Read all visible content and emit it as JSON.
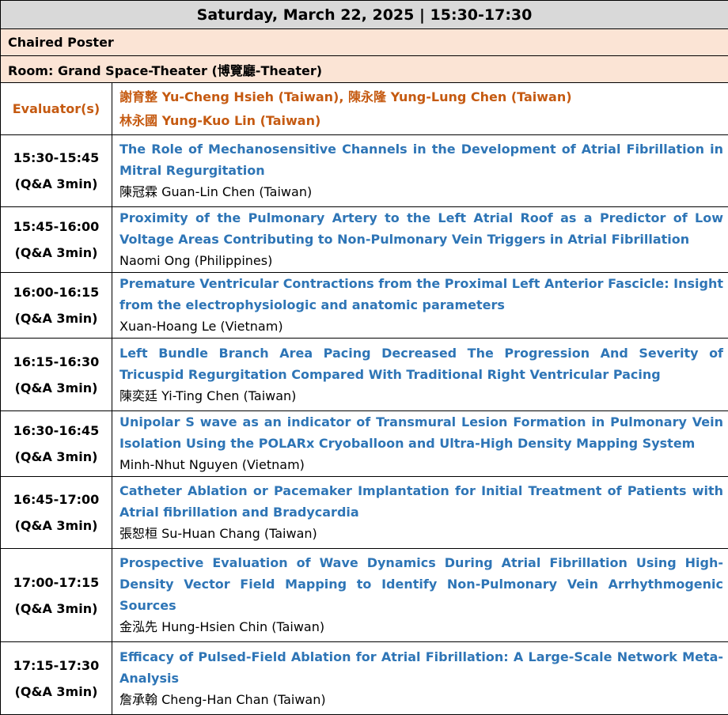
{
  "header": {
    "date_time": "Saturday, March 22, 2025 | 15:30-17:30",
    "session_type": "Chaired Poster",
    "room": "Room: Grand Space-Theater (博覽廳-Theater)"
  },
  "evaluators": {
    "label": "Evaluator(s)",
    "line1": "謝育整 Yu-Cheng Hsieh (Taiwan), 陳永隆 Yung-Lung Chen (Taiwan)",
    "line2": "林永國 Yung-Kuo Lin (Taiwan)"
  },
  "talks": [
    {
      "time": "15:30-15:45",
      "qa": "(Q&A 3min)",
      "title": "The Role of Mechanosensitive Channels in the Development of Atrial Fibrillation in Mitral Regurgitation",
      "speaker": "陳冠霖 Guan-Lin Chen (Taiwan)"
    },
    {
      "time": "15:45-16:00",
      "qa": "(Q&A 3min)",
      "title": "Proximity of the Pulmonary Artery to the Left Atrial Roof as a Predictor of Low Voltage Areas Contributing to Non-Pulmonary Vein Triggers in Atrial Fibrillation",
      "speaker": "Naomi Ong (Philippines)"
    },
    {
      "time": "16:00-16:15",
      "qa": "(Q&A 3min)",
      "title": "Premature Ventricular Contractions from the Proximal Left Anterior Fascicle: Insight from the electrophysiologic and anatomic parameters",
      "speaker": "Xuan-Hoang Le (Vietnam)"
    },
    {
      "time": "16:15-16:30",
      "qa": "(Q&A 3min)",
      "title": "Left Bundle Branch Area Pacing Decreased The Progression And Severity of Tricuspid Regurgitation Compared With Traditional Right Ventricular Pacing",
      "speaker": "陳奕廷 Yi-Ting Chen (Taiwan)"
    },
    {
      "time": "16:30-16:45",
      "qa": "(Q&A 3min)",
      "title": "Unipolar S wave as an indicator of Transmural Lesion Formation in Pulmonary Vein Isolation Using the POLARx Cryoballoon and Ultra-High Density Mapping System",
      "speaker": "Minh-Nhut Nguyen (Vietnam)"
    },
    {
      "time": "16:45-17:00",
      "qa": "(Q&A 3min)",
      "title": "Catheter Ablation or Pacemaker Implantation for Initial Treatment of Patients with Atrial fibrillation and Bradycardia",
      "speaker": "張恕桓 Su-Huan Chang (Taiwan)"
    },
    {
      "time": "17:00-17:15",
      "qa": "(Q&A 3min)",
      "title": "Prospective Evaluation of Wave Dynamics During Atrial Fibrillation Using High-Density Vector Field Mapping to Identify Non-Pulmonary Vein Arrhythmogenic Sources",
      "speaker": "金泓先 Hung-Hsien Chin (Taiwan)"
    },
    {
      "time": "17:15-17:30",
      "qa": "(Q&A 3min)",
      "title": "Efficacy of Pulsed-Field Ablation for Atrial Fibrillation: A Large-Scale Network Meta-Analysis",
      "speaker": "詹承翰 Cheng-Han Chan (Taiwan)"
    }
  ],
  "colors": {
    "header_gray": "#d9d9d9",
    "header_peach": "#fbe4d5",
    "evaluator_orange": "#c55a11",
    "title_blue": "#2e75b6"
  }
}
